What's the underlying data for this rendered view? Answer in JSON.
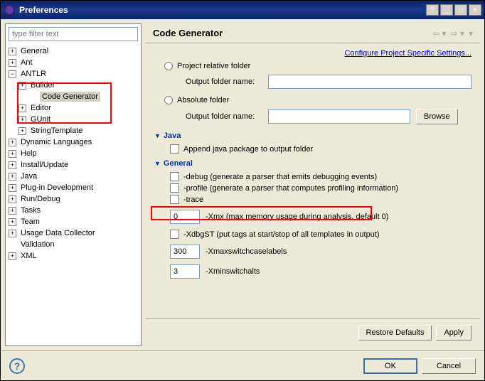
{
  "window": {
    "title": "Preferences"
  },
  "sidebar": {
    "filter_placeholder": "type filter text",
    "items": [
      {
        "label": "General",
        "exp": "+",
        "lvl": 0
      },
      {
        "label": "Ant",
        "exp": "+",
        "lvl": 0
      },
      {
        "label": "ANTLR",
        "exp": "−",
        "lvl": 0
      },
      {
        "label": "Builder",
        "exp": "+",
        "lvl": 1
      },
      {
        "label": "Code Generator",
        "exp": "",
        "lvl": 2,
        "selected": true
      },
      {
        "label": "Editor",
        "exp": "+",
        "lvl": 1
      },
      {
        "label": "GUnit",
        "exp": "+",
        "lvl": 1
      },
      {
        "label": "StringTemplate",
        "exp": "+",
        "lvl": 1
      },
      {
        "label": "Dynamic Languages",
        "exp": "+",
        "lvl": 0
      },
      {
        "label": "Help",
        "exp": "+",
        "lvl": 0
      },
      {
        "label": "Install/Update",
        "exp": "+",
        "lvl": 0
      },
      {
        "label": "Java",
        "exp": "+",
        "lvl": 0
      },
      {
        "label": "Plug-in Development",
        "exp": "+",
        "lvl": 0
      },
      {
        "label": "Run/Debug",
        "exp": "+",
        "lvl": 0
      },
      {
        "label": "Tasks",
        "exp": "+",
        "lvl": 0
      },
      {
        "label": "Team",
        "exp": "+",
        "lvl": 0
      },
      {
        "label": "Usage Data Collector",
        "exp": "+",
        "lvl": 0
      },
      {
        "label": "Validation",
        "exp": "",
        "lvl": 0
      },
      {
        "label": "XML",
        "exp": "+",
        "lvl": 0
      }
    ]
  },
  "page": {
    "title": "Code Generator",
    "config_link": "Configure Project Specific Settings...",
    "radio_project": "Project relative folder",
    "radio_absolute": "Absolute folder",
    "output_label": "Output folder name:",
    "browse": "Browse",
    "java_section": "Java",
    "java_append": "Append java package to output folder",
    "general_section": "General",
    "opt_debug": "-debug (generate a parser that emits debugging events)",
    "opt_profile": "-profile (generate a parser that computes profiling information)",
    "opt_trace": "-trace",
    "opt_xmx": "-Xmx (max memory usage during analysis, default 0)",
    "xmx_val": "0",
    "opt_xdbgst": "-XdbgST (put tags at start/stop of all templates in output)",
    "opt_xmaxswitch": "-Xmaxswitchcaselabels",
    "xmaxswitch_val": "300",
    "opt_xminswitch": "-Xminswitchalts",
    "xminswitch_val": "3",
    "restore": "Restore Defaults",
    "apply": "Apply"
  },
  "footer": {
    "ok": "OK",
    "cancel": "Cancel"
  }
}
